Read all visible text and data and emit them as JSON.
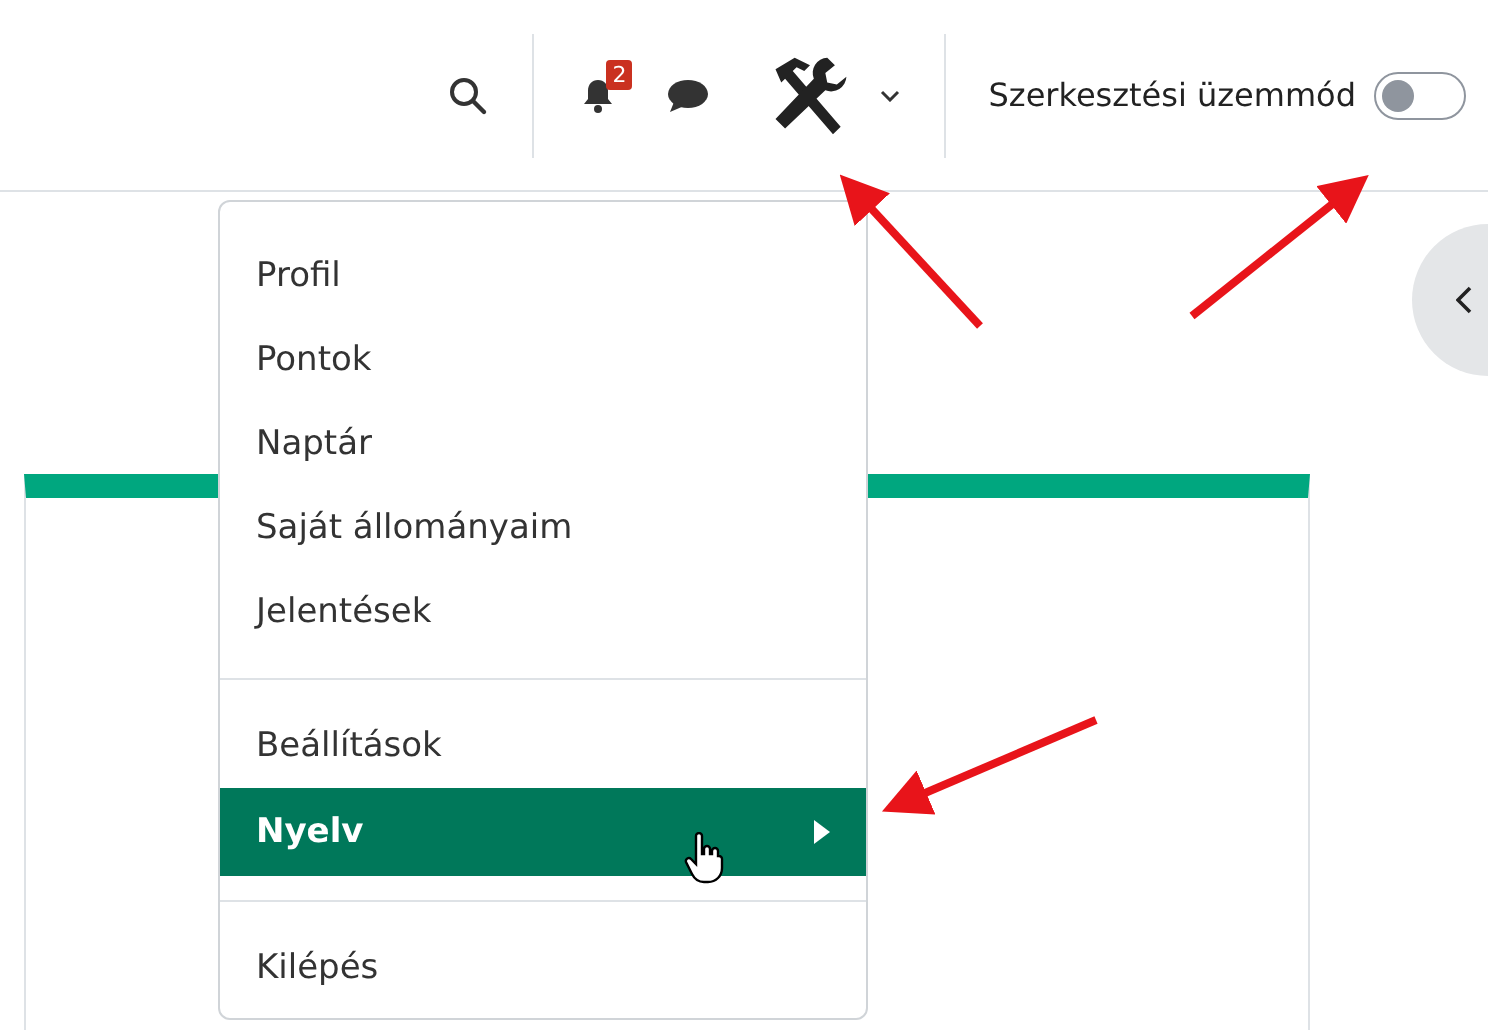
{
  "header": {
    "notifications": {
      "badge": "2"
    },
    "edit_mode": {
      "label": "Szerkesztési üzemmód",
      "on": false
    }
  },
  "user_menu": {
    "groups": [
      {
        "items": [
          {
            "label": "Profil",
            "selected": false,
            "has_submenu": false
          },
          {
            "label": "Pontok",
            "selected": false,
            "has_submenu": false
          },
          {
            "label": "Naptár",
            "selected": false,
            "has_submenu": false
          },
          {
            "label": "Saját állományaim",
            "selected": false,
            "has_submenu": false
          },
          {
            "label": "Jelentések",
            "selected": false,
            "has_submenu": false
          }
        ]
      },
      {
        "items": [
          {
            "label": "Beállítások",
            "selected": false,
            "has_submenu": false
          },
          {
            "label": "Nyelv",
            "selected": true,
            "has_submenu": true
          }
        ]
      },
      {
        "items": [
          {
            "label": "Kilépés",
            "selected": false,
            "has_submenu": false
          }
        ]
      }
    ]
  }
}
